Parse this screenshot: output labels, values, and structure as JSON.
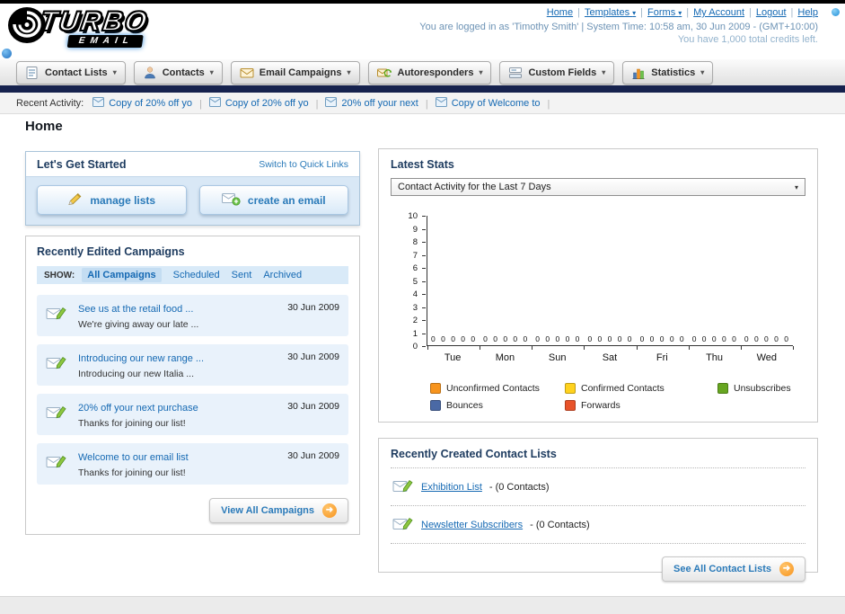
{
  "header": {
    "logo_text": "TURBO",
    "logo_sub": "EMAIL",
    "nav_links": [
      {
        "label": "Home",
        "caret": false
      },
      {
        "label": "Templates",
        "caret": true
      },
      {
        "label": "Forms",
        "caret": true
      },
      {
        "label": "My Account",
        "caret": false
      },
      {
        "label": "Logout",
        "caret": false
      },
      {
        "label": "Help",
        "caret": false
      }
    ],
    "login_info": "You are logged in as 'Timothy Smith' | System Time: 10:58 am, 30 Jun 2009 - (GMT+10:00)",
    "credits_info": "You have 1,000 total credits left."
  },
  "main_nav": {
    "tabs": [
      {
        "label": "Contact Lists",
        "icon": "contact-lists-icon"
      },
      {
        "label": "Contacts",
        "icon": "contacts-icon"
      },
      {
        "label": "Email Campaigns",
        "icon": "email-campaigns-icon"
      },
      {
        "label": "Autoresponders",
        "icon": "autoresponders-icon"
      },
      {
        "label": "Custom Fields",
        "icon": "custom-fields-icon"
      },
      {
        "label": "Statistics",
        "icon": "statistics-icon"
      }
    ]
  },
  "recent_activity": {
    "label": "Recent Activity:",
    "items": [
      "Copy of 20% off yo",
      "Copy of 20% off yo",
      "20% off your next",
      "Copy of Welcome to"
    ]
  },
  "page_title": "Home",
  "get_started": {
    "title": "Let's Get Started",
    "switch_link": "Switch to Quick Links",
    "buttons": [
      {
        "label": "manage lists"
      },
      {
        "label": "create an email"
      }
    ]
  },
  "campaigns": {
    "title": "Recently Edited Campaigns",
    "show_label": "SHOW:",
    "filters": [
      "All Campaigns",
      "Scheduled",
      "Sent",
      "Archived"
    ],
    "active_filter": "All Campaigns",
    "rows": [
      {
        "title": "See us at the retail food ...",
        "subtitle": "We're giving away our late ...",
        "date": "30 Jun 2009"
      },
      {
        "title": "Introducing our new range ...",
        "subtitle": "Introducing our new Italia ...",
        "date": "30 Jun 2009"
      },
      {
        "title": "20% off your next purchase",
        "subtitle": "Thanks for joining our list!",
        "date": "30 Jun 2009"
      },
      {
        "title": "Welcome to our email list",
        "subtitle": "Thanks for joining our list!",
        "date": "30 Jun 2009"
      }
    ],
    "view_all_label": "View All Campaigns"
  },
  "stats": {
    "title": "Latest Stats",
    "dropdown_value": "Contact Activity for the Last 7 Days",
    "chart_data": {
      "type": "bar",
      "title": "Contact Activity for the Last 7 Days",
      "categories": [
        "Tue",
        "Mon",
        "Sun",
        "Sat",
        "Fri",
        "Thu",
        "Wed"
      ],
      "series": [
        {
          "name": "Unconfirmed Contacts",
          "color": "#f7941d",
          "values": [
            0,
            0,
            0,
            0,
            0,
            0,
            0
          ]
        },
        {
          "name": "Confirmed Contacts",
          "color": "#ffd21e",
          "values": [
            0,
            0,
            0,
            0,
            0,
            0,
            0
          ]
        },
        {
          "name": "Unsubscribes",
          "color": "#67a621",
          "values": [
            0,
            0,
            0,
            0,
            0,
            0,
            0
          ]
        },
        {
          "name": "Bounces",
          "color": "#4a69a5",
          "values": [
            0,
            0,
            0,
            0,
            0,
            0,
            0
          ]
        },
        {
          "name": "Forwards",
          "color": "#e8532a",
          "values": [
            0,
            0,
            0,
            0,
            0,
            0,
            0
          ]
        }
      ],
      "xlabel": "",
      "ylabel": "",
      "ylim": [
        0,
        10
      ],
      "yticks": [
        0,
        1,
        2,
        3,
        4,
        5,
        6,
        7,
        8,
        9,
        10
      ],
      "grid": false,
      "legend_position": "bottom"
    }
  },
  "contact_lists": {
    "title": "Recently Created Contact Lists",
    "items": [
      {
        "name": "Exhibition List",
        "suffix": "- (0 Contacts)"
      },
      {
        "name": "Newsletter Subscribers",
        "suffix": "- (0 Contacts)"
      }
    ],
    "see_all_label": "See All Contact Lists"
  }
}
